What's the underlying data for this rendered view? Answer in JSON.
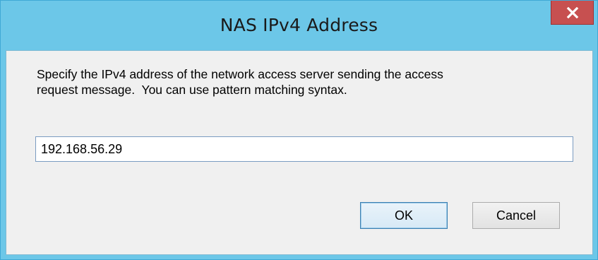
{
  "dialog": {
    "title": "NAS IPv4 Address",
    "close_icon": "close-icon",
    "prompt": "Specify the IPv4 address of the network access server sending the access\nrequest message.  You can use pattern matching syntax.",
    "ip_value": "192.168.56.29",
    "ok_label": "OK",
    "cancel_label": "Cancel"
  },
  "colors": {
    "title_bar": "#6cc7e8",
    "close_button": "#c75050",
    "client_bg": "#f0f0f0",
    "default_button_border": "#3c7fb1"
  }
}
